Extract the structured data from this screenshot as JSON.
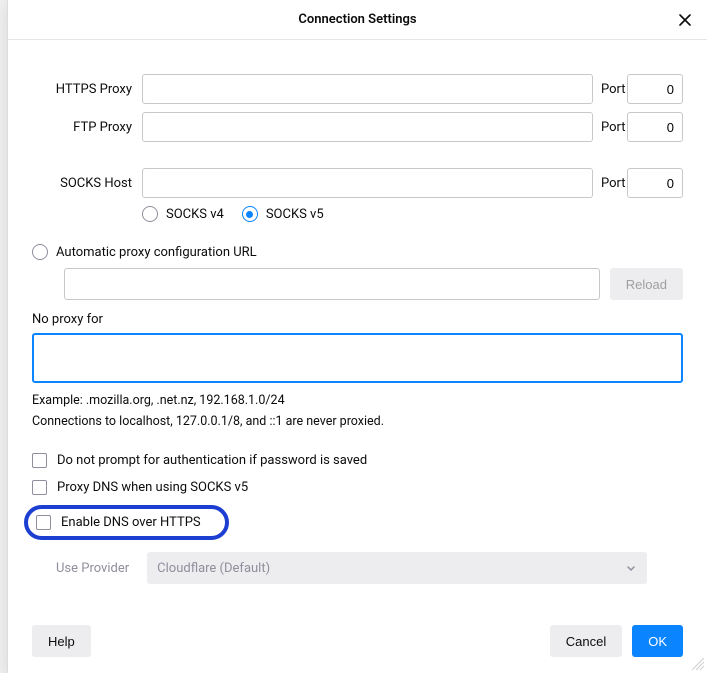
{
  "dialog": {
    "title": "Connection Settings"
  },
  "proxy": {
    "https": {
      "label": "HTTPS Proxy",
      "value": "",
      "port_label": "Port",
      "port": "0"
    },
    "ftp": {
      "label": "FTP Proxy",
      "value": "",
      "port_label": "Port",
      "port": "0"
    },
    "socks": {
      "label": "SOCKS Host",
      "value": "",
      "port_label": "Port",
      "port": "0"
    },
    "socks_version": {
      "v4": "SOCKS v4",
      "v5": "SOCKS v5",
      "selected": "v5"
    }
  },
  "autoconfig": {
    "label": "Automatic proxy configuration URL",
    "value": "",
    "reload": "Reload"
  },
  "noproxy": {
    "label": "No proxy for",
    "value": "",
    "example": "Example: .mozilla.org, .net.nz, 192.168.1.0/24",
    "note": "Connections to localhost, 127.0.0.1/8, and ::1 are never proxied."
  },
  "checkboxes": {
    "no_prompt": "Do not prompt for authentication if password is saved",
    "proxy_dns": "Proxy DNS when using SOCKS v5",
    "doh": "Enable DNS over HTTPS"
  },
  "provider": {
    "label": "Use Provider",
    "value": "Cloudflare (Default)"
  },
  "buttons": {
    "help": "Help",
    "cancel": "Cancel",
    "ok": "OK"
  }
}
